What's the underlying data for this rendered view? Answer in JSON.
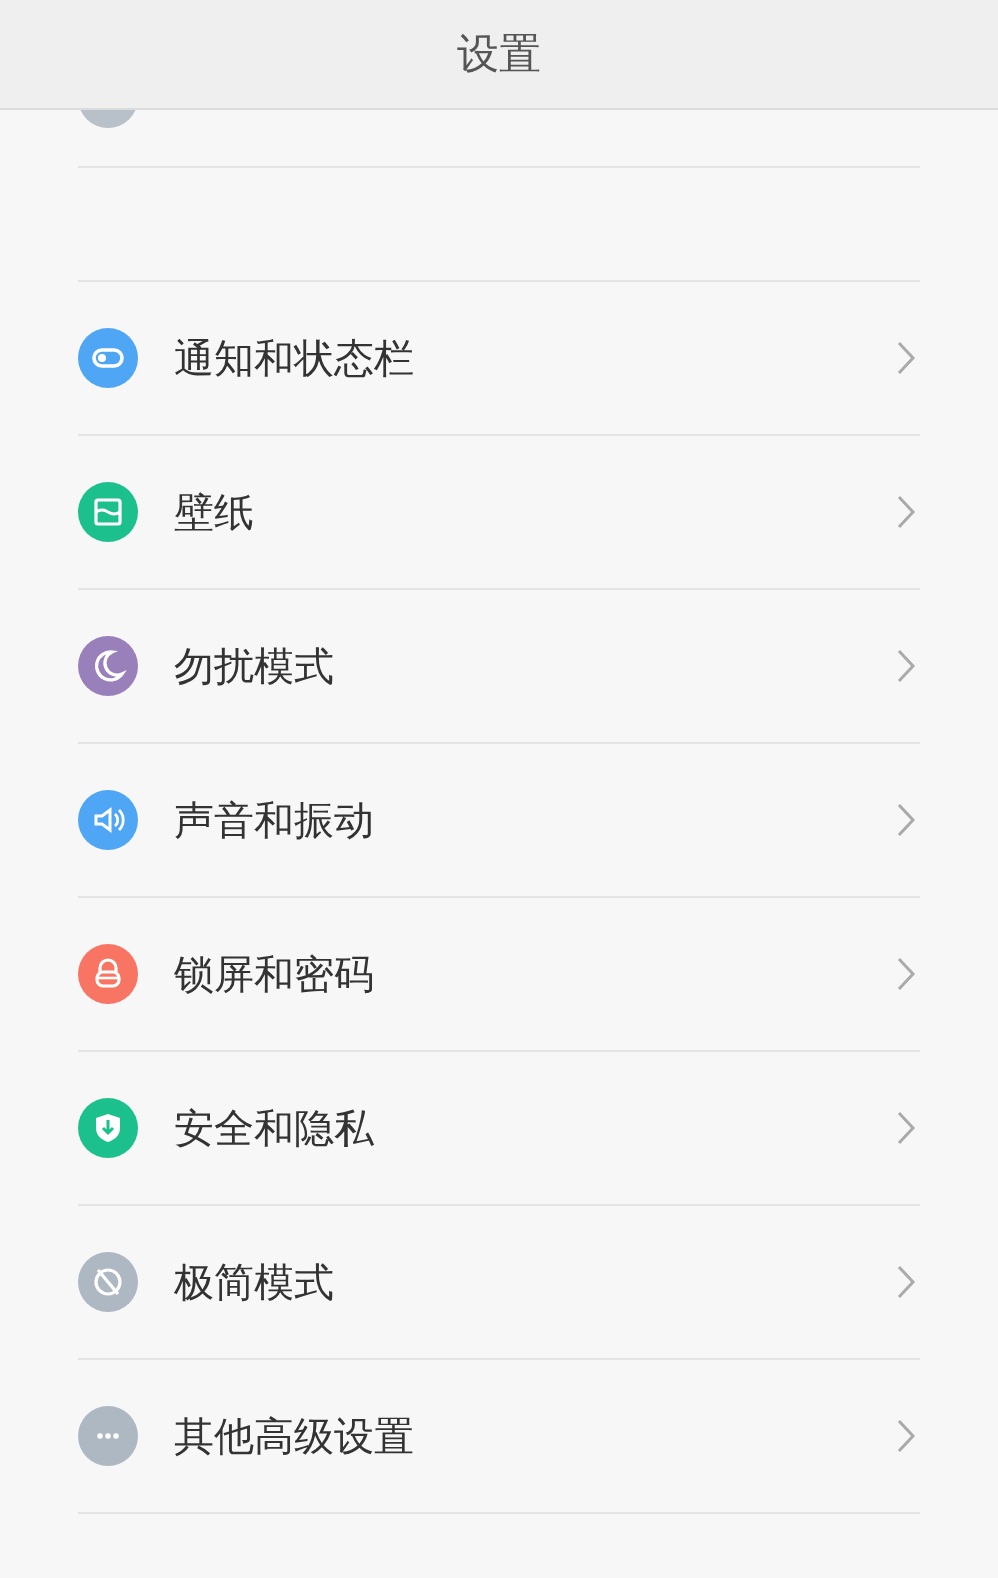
{
  "header": {
    "title": "设置"
  },
  "partial_item": {
    "color": "#b8c0ca"
  },
  "items": [
    {
      "label": "通知和状态栏",
      "color": "#4ea6f4"
    },
    {
      "label": "壁纸",
      "color": "#1cc08d"
    },
    {
      "label": "勿扰模式",
      "color": "#9a80bb"
    },
    {
      "label": "声音和振动",
      "color": "#4ea6f4"
    },
    {
      "label": "锁屏和密码",
      "color": "#f87563"
    },
    {
      "label": "安全和隐私",
      "color": "#1cc08d"
    },
    {
      "label": "极简模式",
      "color": "#aeb8c3"
    },
    {
      "label": "其他高级设置",
      "color": "#aeb8c3"
    }
  ]
}
